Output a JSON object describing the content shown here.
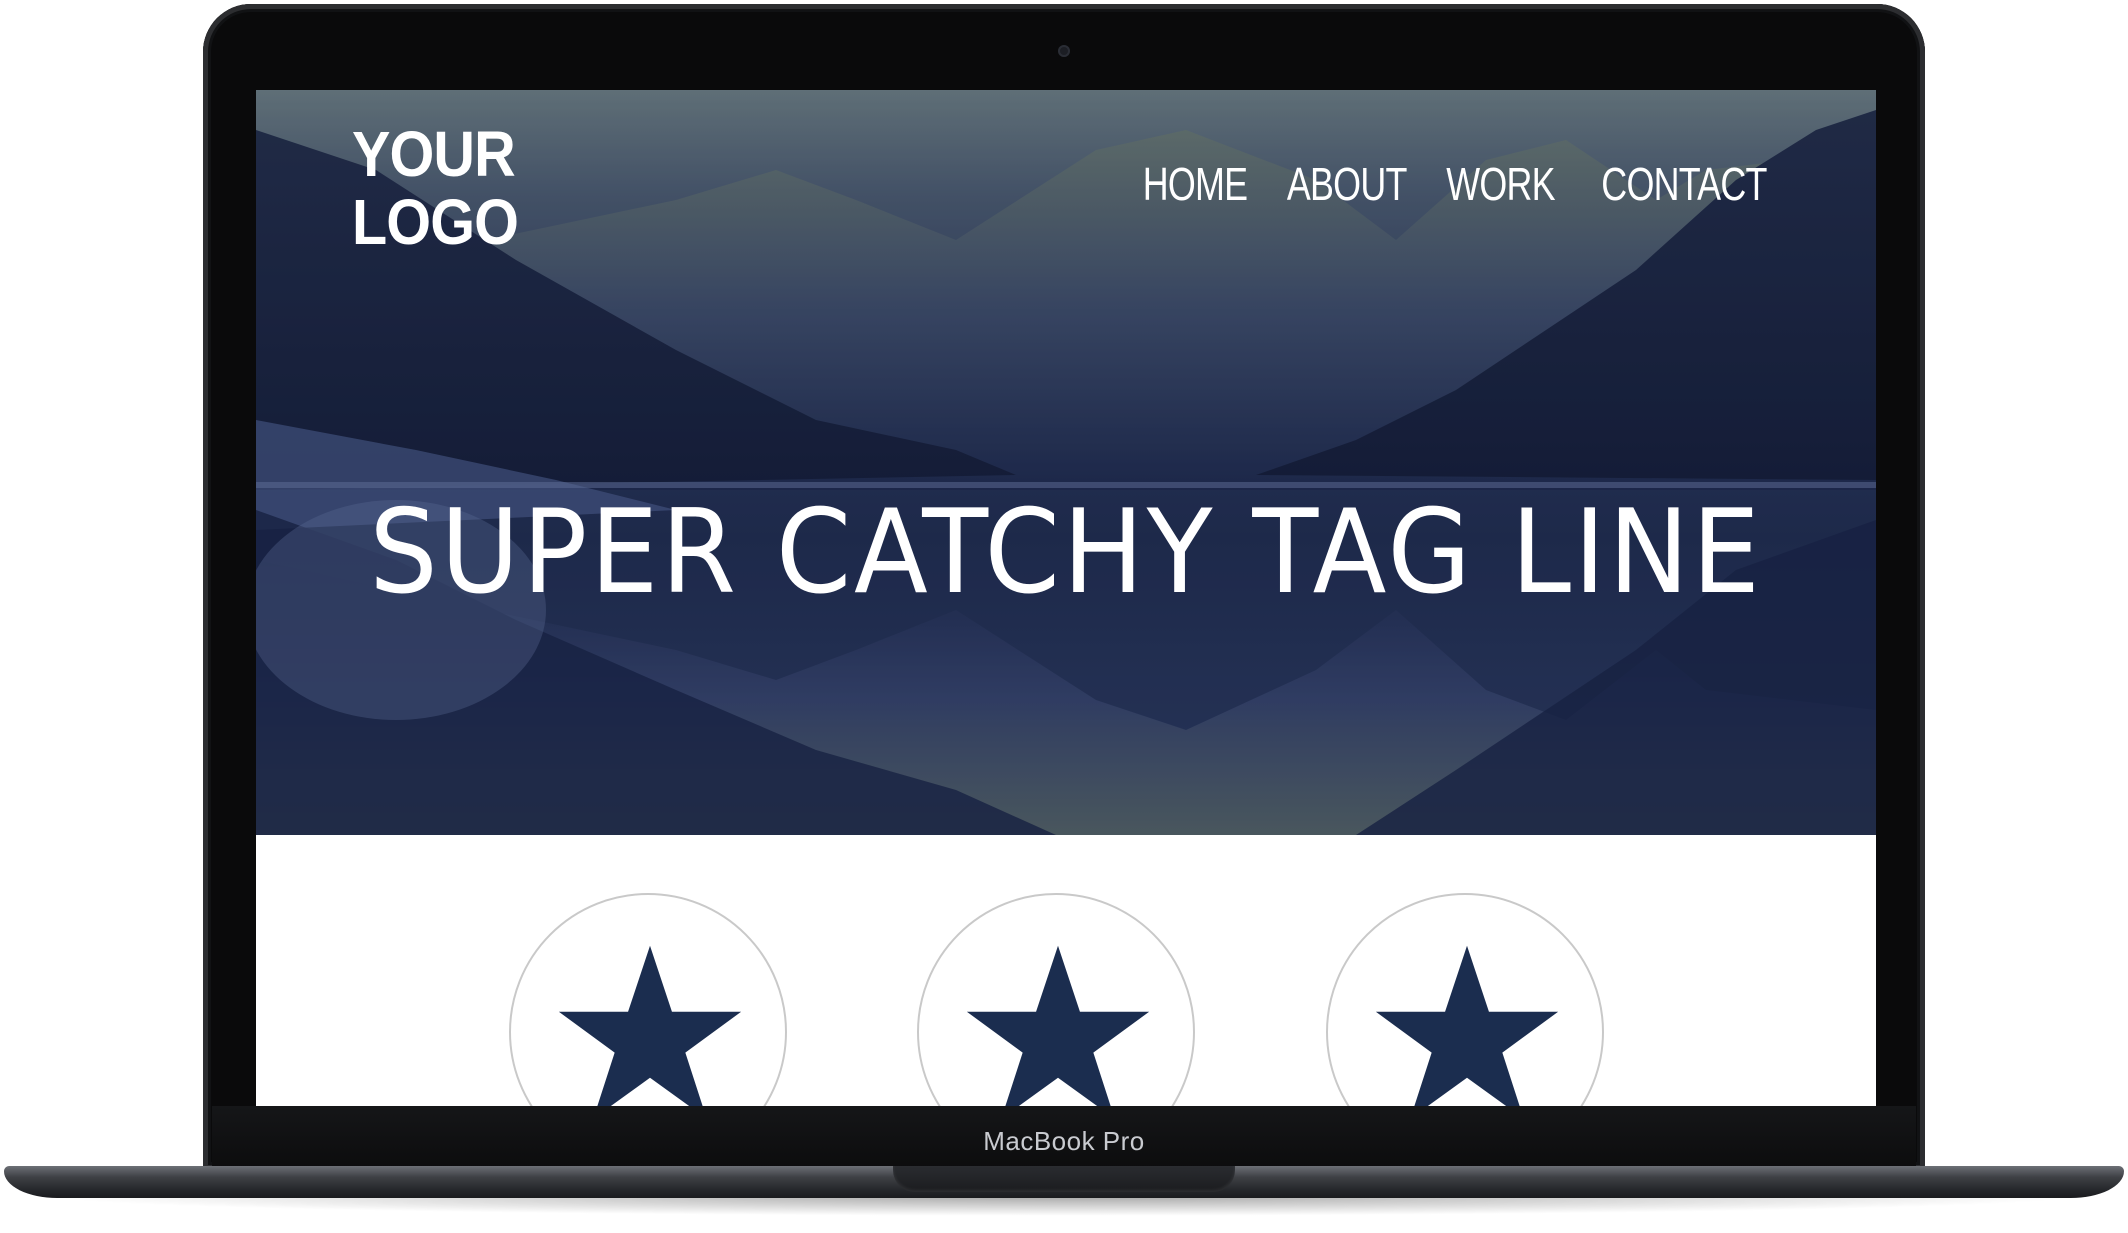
{
  "device": {
    "brand_label": "MacBook Pro"
  },
  "site": {
    "logo": {
      "line1": "YOUR",
      "line2": "LOGO"
    },
    "nav": [
      {
        "label": "HOME"
      },
      {
        "label": "ABOUT"
      },
      {
        "label": "WORK"
      },
      {
        "label": "CONTACT"
      }
    ],
    "hero": {
      "tagline": "SUPER CATCHY TAG LINE"
    },
    "features": [
      {
        "icon": "star-icon"
      },
      {
        "icon": "star-icon"
      },
      {
        "icon": "star-icon"
      }
    ]
  },
  "colors": {
    "accent": "#1b2d4f",
    "hero_overlay": "#1f2b4a",
    "circle_border": "#c9c9c9",
    "nav_text": "#ffffff"
  }
}
